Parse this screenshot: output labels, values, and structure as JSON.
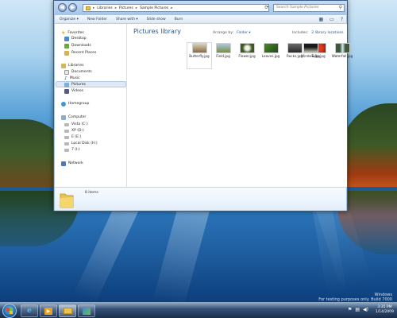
{
  "window": {
    "address": {
      "crumbs": [
        "Libraries",
        "Pictures",
        "Sample Pictures"
      ],
      "separator": "▸"
    },
    "search_placeholder": "Search Sample Pictures",
    "toolbar": {
      "organize": "Organize ▾",
      "new_folder": "New Folder",
      "share_with": "Share with ▾",
      "slide_show": "Slide show",
      "burn": "Burn"
    }
  },
  "navigation": {
    "favorites": {
      "label": "Favorites",
      "items": [
        "Desktop",
        "Downloads",
        "Recent Places"
      ]
    },
    "libraries": {
      "label": "Libraries",
      "items": [
        "Documents",
        "Music",
        "Pictures",
        "Videos"
      ]
    },
    "homegroup": "Homegroup",
    "computer": {
      "label": "Computer",
      "items": [
        "Vista (C:)",
        "XP (D:)",
        "E (E:)",
        "Local Disk (H:)",
        "7 (I:)"
      ]
    },
    "network": "Network"
  },
  "content": {
    "title": "Pictures library",
    "arrange_label": "Arrange by:",
    "arrange_value": "Folder ▾",
    "includes_label": "Includes:",
    "includes_link": "2 library locations",
    "files": [
      {
        "name": "Butterfly.jpg",
        "color_top": "#d9d2b8",
        "color_bottom": "#8a6a3e"
      },
      {
        "name": "Field.jpg",
        "color_top": "#a9c9e8",
        "color_bottom": "#7a8f3a"
      },
      {
        "name": "Flower.jpg",
        "color_top": "#f2f2e6",
        "color_bottom": "#3a5a1e"
      },
      {
        "name": "Leaves.jpg",
        "color_top": "#4a8a2a",
        "color_bottom": "#1e4a14"
      },
      {
        "name": "Rocks.jpg",
        "color_top": "#6a6a6a",
        "color_bottom": "#2a2a2a"
      },
      {
        "name": "Tulip.jpg",
        "color_top": "#e23a1a",
        "color_bottom": "#8a1a0a"
      },
      {
        "name": "Waterfall.jpg",
        "color_top": "#3a5a3a",
        "color_bottom": "#d8e6f0"
      },
      {
        "name": "Window.jpg",
        "color_top": "#1a1a1a",
        "color_bottom": "#c8c8b8"
      }
    ]
  },
  "details": {
    "count": "8 items"
  },
  "taskbar": {
    "time": "3:35 PM",
    "date": "1/14/2009"
  },
  "watermark": {
    "line1": "Windows",
    "line2": "For testing purposes only. Build 7000"
  },
  "colors": {
    "accent": "#1e5a9a",
    "window_frame": "#a9c6e6"
  }
}
